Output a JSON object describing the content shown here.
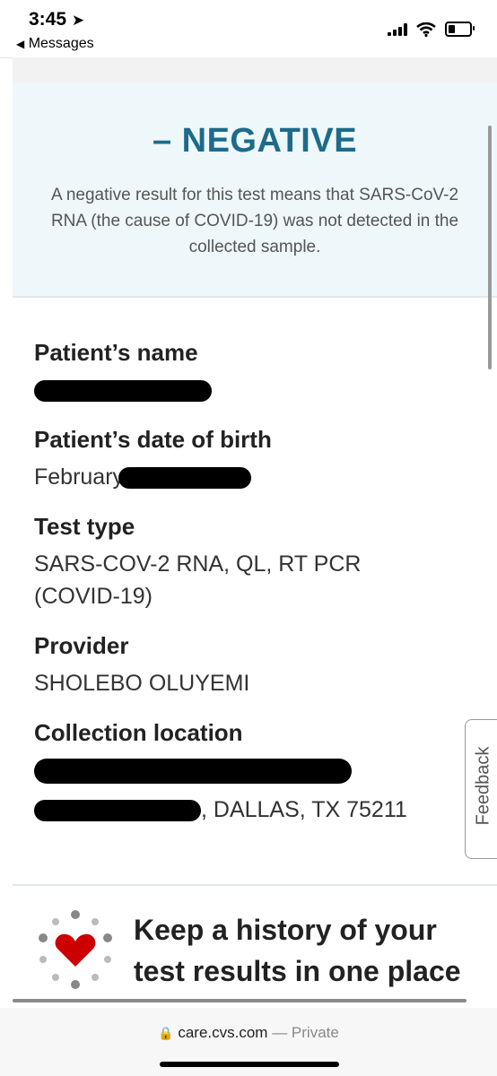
{
  "status": {
    "time": "3:45",
    "back_label": "Messages"
  },
  "result": {
    "title": "– NEGATIVE",
    "description": "A negative result for this test means that SARS-CoV-2 RNA (the cause of COVID-19) was not detected in the collected sample."
  },
  "fields": {
    "name_label": "Patient’s name",
    "dob_label": "Patient’s date of birth",
    "dob_visible": "February",
    "test_type_label": "Test type",
    "test_type_value": "SARS-COV-2 RNA, QL, RT PCR (COVID-19)",
    "provider_label": "Provider",
    "provider_value": "SHOLEBO OLUYEMI",
    "location_label": "Collection location",
    "location_city": ", DALLAS, TX 75211"
  },
  "promo": {
    "text": "Keep a history of your test results in one place"
  },
  "feedback": {
    "label": "Feedback"
  },
  "browser": {
    "url": "care.cvs.com",
    "separator": " — ",
    "private": "Private"
  },
  "colors": {
    "accent": "#1d6b8a",
    "heart": "#cc0000",
    "banner_bg": "#eef7fa"
  }
}
